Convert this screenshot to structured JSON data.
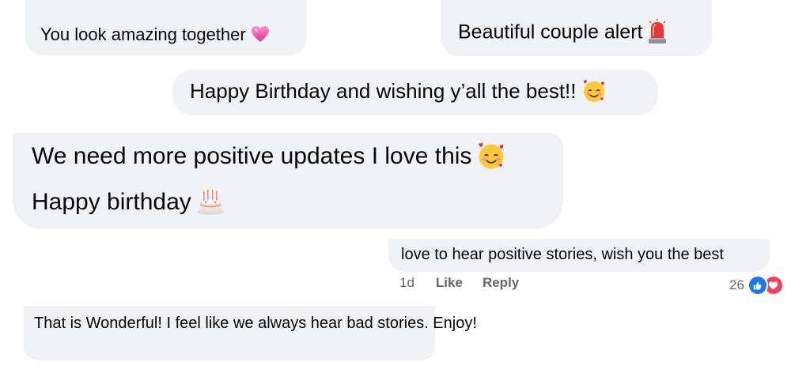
{
  "comments": [
    {
      "id": "b1",
      "text": "You look amazing together",
      "emoji": "pink-heart-icon"
    },
    {
      "id": "b2",
      "text": "Beautiful couple alert",
      "emoji": "siren-icon"
    },
    {
      "id": "b3",
      "text": "Happy Birthday and wishing y’all the best!!",
      "emoji": "smiling-face-with-hearts-icon"
    },
    {
      "id": "b4",
      "line1": "We need more positive updates I love this",
      "line1_emoji": "smiling-face-with-hearts-icon",
      "line2": "Happy birthday",
      "line2_emoji": "birthday-cake-icon"
    },
    {
      "id": "b5",
      "text": "love to hear positive stories, wish you the best"
    },
    {
      "id": "b6",
      "text": "That is Wonderful! I feel like we always hear bad stories. Enjoy!"
    }
  ],
  "comment_meta": {
    "time": "1d",
    "like_label": "Like",
    "reply_label": "Reply",
    "reaction_count": "26",
    "reactions": [
      "like-icon",
      "love-icon"
    ]
  },
  "colors": {
    "bubble": "#f0f2f5",
    "meta_text": "#65676b",
    "like_blue": "#1877f2",
    "love_red": "#f33e58"
  }
}
